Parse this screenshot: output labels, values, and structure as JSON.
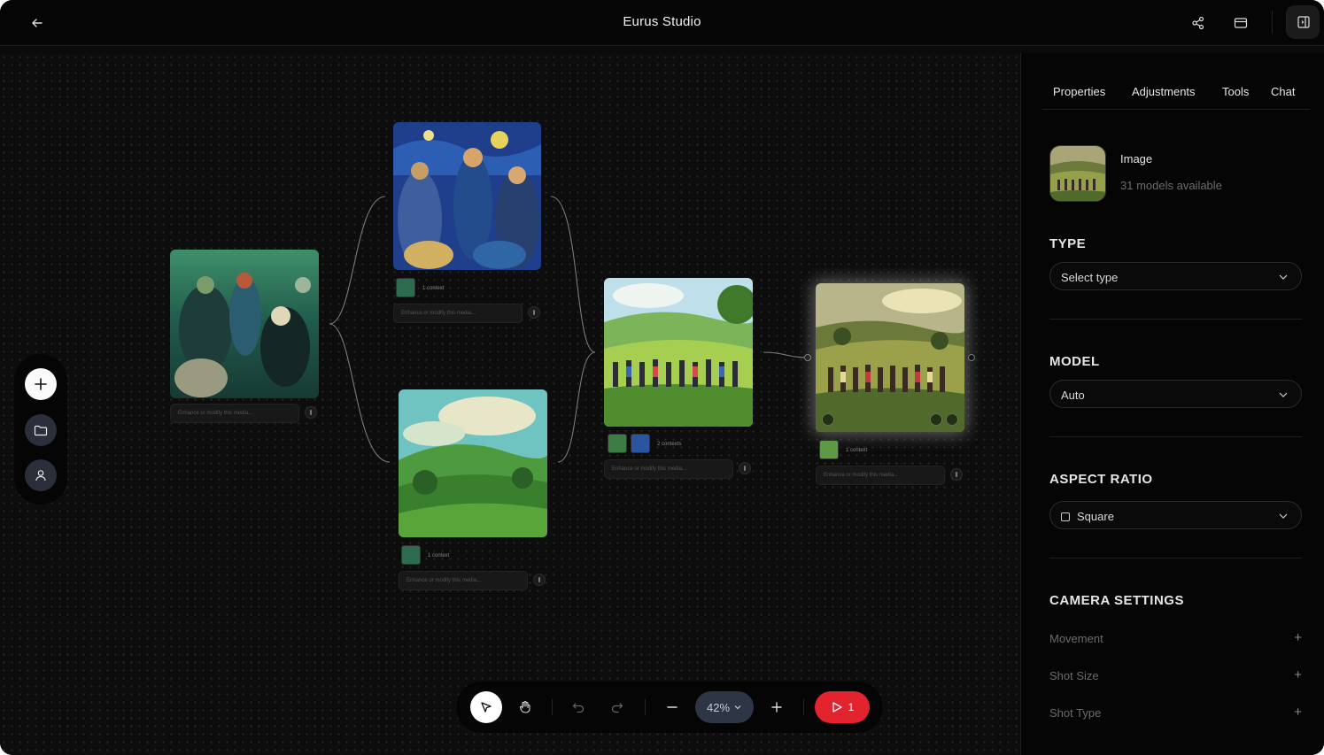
{
  "app": {
    "title": "Eurus Studio"
  },
  "header": {
    "back": "back-arrow-icon",
    "share": "share-icon",
    "layout": "card-layout-icon",
    "panel_toggle": "sidebar-panel-icon"
  },
  "canvas": {
    "side_tools": [
      "plus-icon",
      "folder-icon",
      "user-icon"
    ],
    "nodes": [
      {
        "id": "source",
        "prompt_placeholder": "Enhance or modify this media..."
      },
      {
        "id": "starry-crowd",
        "context_label": "1 context",
        "prompt_placeholder": "Enhance or modify this media..."
      },
      {
        "id": "green-valley",
        "context_label": "1 context",
        "prompt_placeholder": "Enhance or modify this media..."
      },
      {
        "id": "meadow-dance",
        "context_label": "2 contexts",
        "prompt_placeholder": "Enhance or modify this media..."
      },
      {
        "id": "final-output",
        "context_label": "1 context",
        "prompt_placeholder": "Enhance or modify this media..."
      }
    ]
  },
  "toolbar": {
    "zoom": "42%",
    "run_count": "1"
  },
  "panel": {
    "tabs": [
      "Properties",
      "Adjustments",
      "Tools",
      "Chat"
    ],
    "media": {
      "title": "Image",
      "subtitle": "31 models available"
    },
    "type": {
      "title": "TYPE",
      "value": "Select type"
    },
    "model": {
      "title": "MODEL",
      "value": "Auto"
    },
    "aspect": {
      "title": "ASPECT RATIO",
      "value": "Square"
    },
    "camera": {
      "title": "CAMERA SETTINGS",
      "items": [
        "Movement",
        "Shot Size",
        "Shot Type"
      ]
    }
  },
  "colors": {
    "run": "#e3232e",
    "zoom_bg": "#2e3646",
    "canvas": "#0d0d0d"
  }
}
